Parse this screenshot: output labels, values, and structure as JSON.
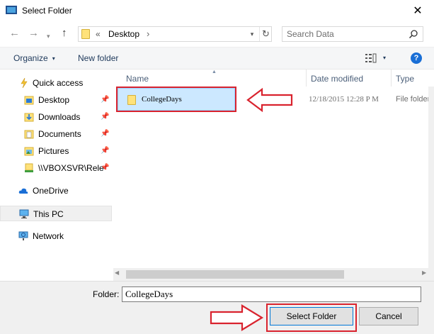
{
  "window": {
    "title": "Select Folder",
    "close_glyph": "✕"
  },
  "nav": {
    "back_glyph": "←",
    "forward_glyph": "→",
    "recent_glyph": "▾",
    "up_glyph": "↑",
    "address_chevron": "«",
    "address_path": "Desktop",
    "address_sep": "›",
    "address_dropdown_glyph": "▾",
    "refresh_glyph": "↻"
  },
  "search": {
    "placeholder": "Search Data"
  },
  "toolbar": {
    "organize_label": "Organize",
    "organize_caret": "▾",
    "new_folder_label": "New folder",
    "view_caret": "▾",
    "help_glyph": "?"
  },
  "sidebar": {
    "quick_access": "Quick access",
    "items": [
      {
        "label": "Desktop",
        "pin": "📌"
      },
      {
        "label": "Downloads",
        "pin": "📌"
      },
      {
        "label": "Documents",
        "pin": "📌"
      },
      {
        "label": "Pictures",
        "pin": "📌"
      },
      {
        "label": "\\\\VBOXSVR\\Rele",
        "pin": "📌"
      }
    ],
    "onedrive": "OneDrive",
    "this_pc": "This PC",
    "network": "Network"
  },
  "columns": {
    "name": "Name",
    "sort_glyph": "▲",
    "date": "Date modified",
    "type": "Type"
  },
  "files": [
    {
      "name": "CollegeDays",
      "date": "12/18/2015  12:28 P M",
      "type": "File folder"
    }
  ],
  "scroll": {
    "left_glyph": "◀",
    "right_glyph": "▶"
  },
  "footer": {
    "folder_label": "Folder:",
    "folder_value": "CollegeDays",
    "select_label": "Select Folder",
    "cancel_label": "Cancel"
  },
  "colors": {
    "annotation_red": "#d9232e",
    "selection_blue": "#cce8ff",
    "accent": "#0078d7"
  }
}
